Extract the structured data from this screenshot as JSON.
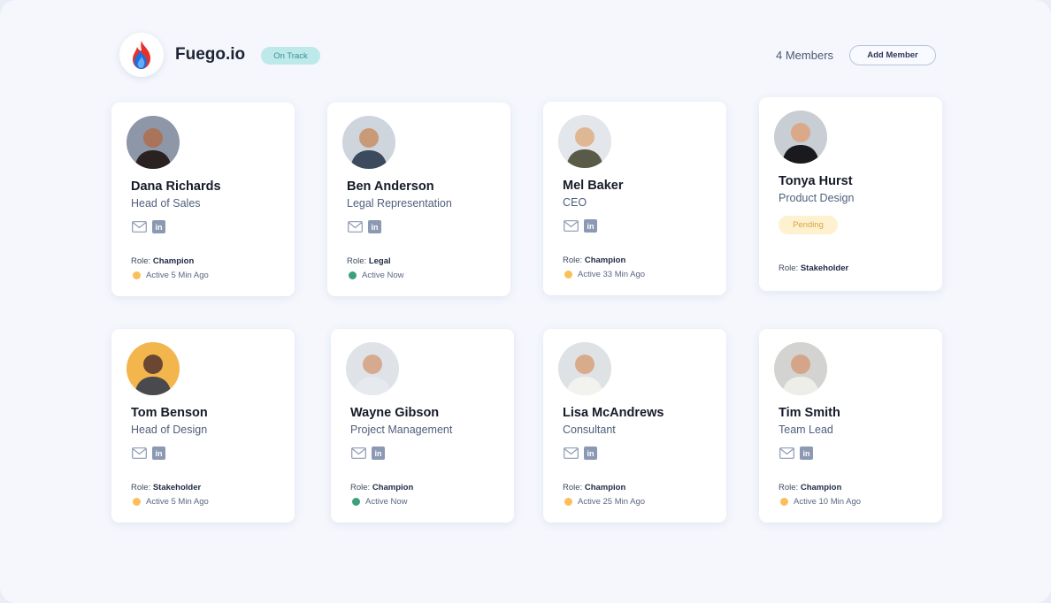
{
  "header": {
    "brand": "Fuego.io",
    "status": "On Track",
    "members_count": "4 Members",
    "add_member_label": "Add Member"
  },
  "colors": {
    "active_now": "#3e9f7e",
    "away": "#fbbf59",
    "status_bg": "#bde9ea",
    "pending_bg": "#fdf1cf"
  },
  "role_prefix": "Role:",
  "members": [
    {
      "name": "Dana Richards",
      "title": "Head of Sales",
      "role": "Champion",
      "activity": "Active 5 Min Ago",
      "status": "away",
      "avatar_icon": "person-avatar-icon"
    },
    {
      "name": "Ben Anderson",
      "title": "Legal Representation",
      "role": "Legal",
      "activity": "Active Now",
      "status": "active",
      "avatar_icon": "person-avatar-icon"
    },
    {
      "name": "Mel Baker",
      "title": "CEO",
      "role": "Champion",
      "activity": "Active 33 Min Ago",
      "status": "away",
      "avatar_icon": "person-avatar-icon"
    },
    {
      "name": "Tonya Hurst",
      "title": "Product Design",
      "role": "Stakeholder",
      "badge": "Pending",
      "status": "pending",
      "avatar_icon": "person-avatar-icon"
    },
    {
      "name": "Tom Benson",
      "title": "Head of Design",
      "role": "Stakeholder",
      "activity": "Active 5 Min Ago",
      "status": "away",
      "avatar_icon": "person-avatar-icon"
    },
    {
      "name": "Wayne Gibson",
      "title": "Project Management",
      "role": "Champion",
      "activity": "Active Now",
      "status": "active",
      "avatar_icon": "person-avatar-icon"
    },
    {
      "name": "Lisa McAndrews",
      "title": "Consultant",
      "role": "Champion",
      "activity": "Active 25 Min Ago",
      "status": "away",
      "avatar_icon": "person-avatar-icon"
    },
    {
      "name": "Tim Smith",
      "title": "Team Lead",
      "role": "Champion",
      "activity": "Active 10 Min Ago",
      "status": "away",
      "avatar_icon": "person-avatar-icon"
    }
  ]
}
